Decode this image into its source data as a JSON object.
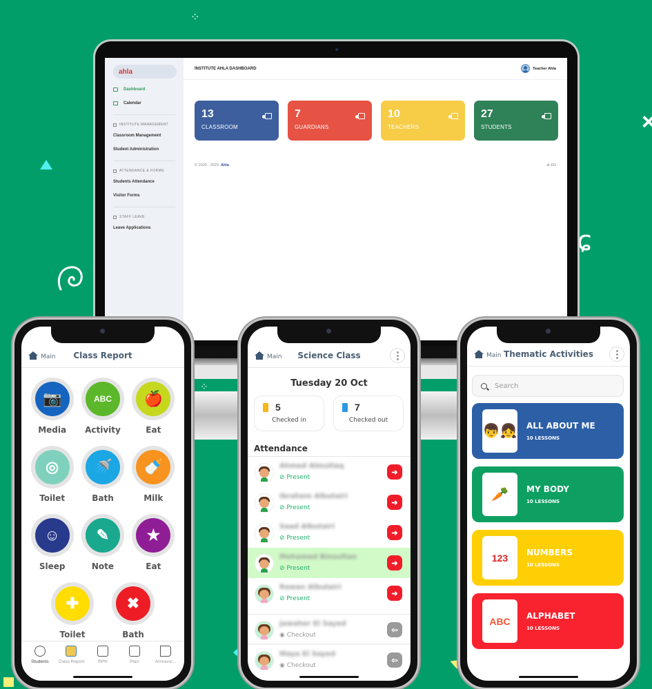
{
  "colors": {
    "background": "#019e6a",
    "classroom": "#3d5f9e",
    "guardians": "#e65243",
    "teachers": "#f7cc47",
    "students": "#2f8157",
    "present": "#1fae6c",
    "checkout_action": "#f11c2a"
  },
  "laptop": {
    "sidebar": {
      "logo_text": "ahla",
      "items": [
        {
          "label": "Dashboard",
          "icon": "monitor-icon",
          "active": true
        },
        {
          "label": "Calendar",
          "icon": "calendar-icon",
          "active": false
        }
      ],
      "sections": [
        {
          "heading": "INSTITUTE MANAGEMENT",
          "icon": "institute-icon",
          "links": [
            "Classroom Management",
            "Student Administration"
          ]
        },
        {
          "heading": "ATTENDANCE & FORMS",
          "icon": "attendance-icon",
          "links": [
            "Students Attendance",
            "Visitor Forms"
          ]
        },
        {
          "heading": "STAFF LEAVE",
          "icon": "leave-icon",
          "links": [
            "Leave Applications"
          ]
        }
      ]
    },
    "header": {
      "title": "INSTITUTE AHLA DASHBOARD",
      "user_name": "Teacher Ahla"
    },
    "cards": [
      {
        "value": "13",
        "label": "CLASSROOM",
        "icon": "teacher-board-icon"
      },
      {
        "value": "7",
        "label": "GUARDIANS",
        "icon": "teacher-board-icon"
      },
      {
        "value": "10",
        "label": "TEACHERS",
        "icon": "user-tie-icon"
      },
      {
        "value": "27",
        "label": "STUDENTS",
        "icon": "graduate-icon"
      }
    ],
    "footer": {
      "copyright": "© 2020 - 2023",
      "brand": "Ahla",
      "language": "EN"
    }
  },
  "phone_class_report": {
    "back_label": "Main",
    "title": "Class Report",
    "tiles": [
      {
        "label": "Media",
        "icon": "camera-icon",
        "glyph": "📷",
        "color": "#1565c0"
      },
      {
        "label": "Activity",
        "icon": "abc-blocks-icon",
        "glyph": "ABC",
        "color": "#5cb82a"
      },
      {
        "label": "Eat",
        "icon": "apple-bottle-icon",
        "glyph": "🍎",
        "color": "#c5d81e"
      },
      {
        "label": "Toilet",
        "icon": "toilet-icon",
        "glyph": "◎",
        "color": "#7fd1bd"
      },
      {
        "label": "Bath",
        "icon": "shower-icon",
        "glyph": "🚿",
        "color": "#1ba6e4"
      },
      {
        "label": "Milk",
        "icon": "baby-bottle-icon",
        "glyph": "🍼",
        "color": "#f7931e"
      },
      {
        "label": "Sleep",
        "icon": "sleeping-baby-icon",
        "glyph": "☺",
        "color": "#283a8c"
      },
      {
        "label": "Note",
        "icon": "pencil-icon",
        "glyph": "✎",
        "color": "#1aa88f"
      },
      {
        "label": "Eat",
        "icon": "award-badge-icon",
        "glyph": "★",
        "color": "#8f1e96"
      },
      {
        "label": "Toilet",
        "icon": "first-aid-kit-icon",
        "glyph": "✚",
        "color": "#ffdd00"
      },
      {
        "label": "Bath",
        "icon": "bandage-icon",
        "glyph": "✖",
        "color": "#ee1c25"
      }
    ],
    "tabs": [
      {
        "label": "Students",
        "icon": "child-face-icon"
      },
      {
        "label": "Class Report",
        "icon": "open-book-icon",
        "active": true
      },
      {
        "label": "RPH",
        "icon": "notebook-icon"
      },
      {
        "label": "Plan",
        "icon": "clipboard-icon"
      },
      {
        "label": "Announc...",
        "icon": "megaphone-icon"
      }
    ]
  },
  "phone_attendance": {
    "back_label": "Main",
    "title": "Science Class",
    "date": "Tuesday 20 Oct",
    "checked_in": {
      "count": "5",
      "label": "Checked in"
    },
    "checked_out": {
      "count": "7",
      "label": "Checked out"
    },
    "section_title": "Attendance",
    "students": [
      {
        "name": "Ahmed Almutlaq",
        "status": "Present",
        "avatar": "boy",
        "highlight": false,
        "action": "checkout"
      },
      {
        "name": "Ibrahem Albutairi",
        "status": "Present",
        "avatar": "boy",
        "highlight": false,
        "action": "checkout"
      },
      {
        "name": "Saad Albutairi",
        "status": "Present",
        "avatar": "boy",
        "highlight": false,
        "action": "checkout"
      },
      {
        "name": "Mohamed Binsultan",
        "status": "Present",
        "avatar": "boy",
        "highlight": true,
        "action": "checkout"
      },
      {
        "name": "Rawan Albutairi",
        "status": "Present",
        "avatar": "girl",
        "highlight": false,
        "action": "checkout"
      },
      {
        "name": "Jawaher El Sayed",
        "status": "Checkout",
        "avatar": "girl",
        "highlight": false,
        "action": "checkin"
      },
      {
        "name": "Maya El Sayed",
        "status": "Checkout",
        "avatar": "girl",
        "highlight": false,
        "action": "checkin"
      }
    ]
  },
  "phone_thematic": {
    "back_label": "Main",
    "title": "Thematic Activities",
    "search_placeholder": "Search",
    "themes": [
      {
        "title": "ALL ABOUT ME",
        "lessons": "10 LESSONS",
        "color": "#2d5fa6",
        "icon": "kids-icon",
        "glyph": "👦👧"
      },
      {
        "title": "MY BODY",
        "lessons": "10 LESSONS",
        "color": "#0ea063",
        "icon": "vegetables-icon",
        "glyph": "🥕"
      },
      {
        "title": "NUMBERS",
        "lessons": "10 LESSONS",
        "color": "#ffcf06",
        "icon": "number-balls-icon",
        "glyph": "123"
      },
      {
        "title": "ALPHABET",
        "lessons": "10 LESSONS",
        "color": "#f9222f",
        "icon": "abc-blocks-icon",
        "glyph": "ABC"
      }
    ]
  }
}
